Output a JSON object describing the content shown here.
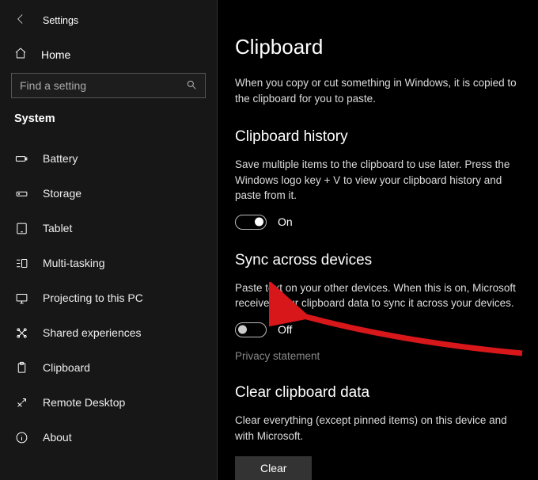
{
  "header": {
    "app_title": "Settings",
    "home_label": "Home",
    "search_placeholder": "Find a setting",
    "section_label": "System"
  },
  "sidebar": {
    "items": [
      {
        "label": "Battery"
      },
      {
        "label": "Storage"
      },
      {
        "label": "Tablet"
      },
      {
        "label": "Multi-tasking"
      },
      {
        "label": "Projecting to this PC"
      },
      {
        "label": "Shared experiences"
      },
      {
        "label": "Clipboard"
      },
      {
        "label": "Remote Desktop"
      },
      {
        "label": "About"
      }
    ]
  },
  "main": {
    "title": "Clipboard",
    "intro": "When you copy or cut something in Windows, it is copied to the clipboard for you to paste.",
    "history": {
      "heading": "Clipboard history",
      "desc": "Save multiple items to the clipboard to use later. Press the Windows logo key + V to view your clipboard history and paste from it.",
      "state_label": "On"
    },
    "sync": {
      "heading": "Sync across devices",
      "desc": "Paste text on your other devices. When this is on, Microsoft receives your clipboard data to sync it across your devices.",
      "state_label": "Off",
      "privacy_link": "Privacy statement"
    },
    "clear": {
      "heading": "Clear clipboard data",
      "desc": "Clear everything (except pinned items) on this device and with Microsoft.",
      "button_label": "Clear"
    }
  },
  "colors": {
    "accent_arrow": "#d8171a"
  }
}
